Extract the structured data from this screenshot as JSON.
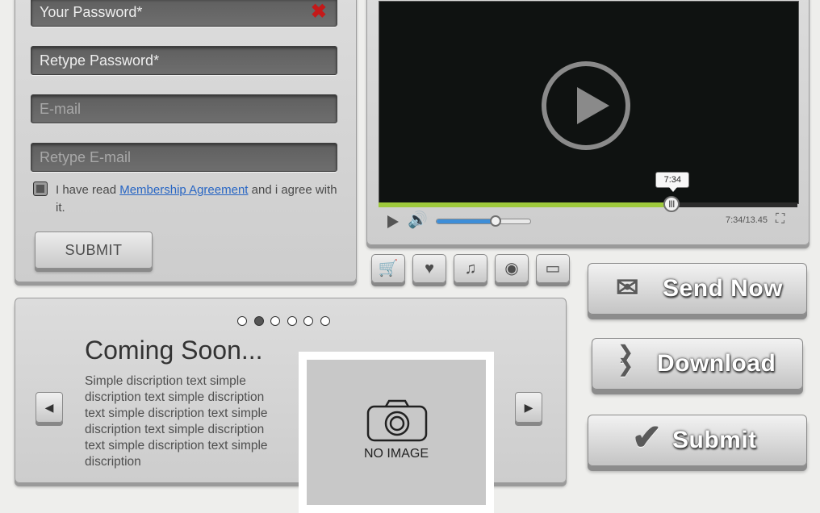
{
  "form": {
    "password_value": "Your Password*",
    "password_error_icon": "close-icon",
    "retype_password_value": "Retype Password*",
    "email_placeholder": "E-mail",
    "retype_email_placeholder": "Retype E-mail",
    "agree_prefix": "I have read ",
    "agree_link": "Membership Agreement",
    "agree_suffix": " and i agree with it.",
    "submit_label": "SUBMIT"
  },
  "video": {
    "progress_fraction": 0.7,
    "progress_tooltip": "7:34",
    "volume_fraction": 0.63,
    "time_label": "7:34/13.45"
  },
  "icon_buttons": [
    {
      "name": "cart-icon",
      "glyph": "🛒"
    },
    {
      "name": "heart-icon",
      "glyph": "♥"
    },
    {
      "name": "music-icon",
      "glyph": "♫"
    },
    {
      "name": "disc-icon",
      "glyph": "◉"
    },
    {
      "name": "folder-icon",
      "glyph": "▭"
    }
  ],
  "actions": {
    "send_now": "Send Now",
    "download": "Download",
    "submit": "Submit"
  },
  "slider": {
    "dot_count": 6,
    "active_dot": 1,
    "title": "Coming Soon...",
    "description": "Simple discription text simple discription text simple discription text simple discription text simple discription text simple discription text simple discription text simple discription",
    "no_image_label": "NO IMAGE"
  }
}
